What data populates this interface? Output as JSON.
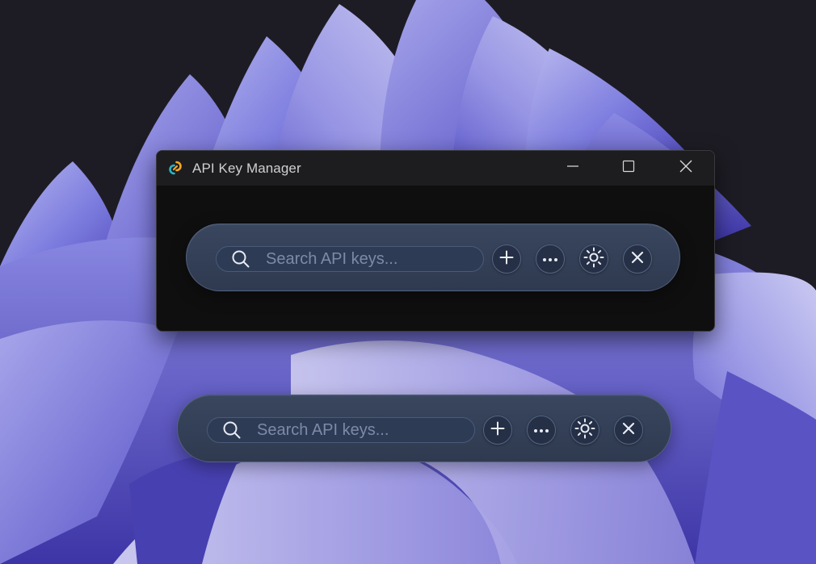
{
  "window": {
    "title": "API Key Manager",
    "app_icon": "link-logo-icon",
    "controls": [
      "minimize-icon",
      "maximize-icon",
      "close-icon"
    ]
  },
  "toolbar": {
    "search_placeholder": "Search API keys...",
    "buttons": [
      {
        "name": "add",
        "icon": "plus-icon"
      },
      {
        "name": "more",
        "icon": "ellipsis-icon"
      },
      {
        "name": "settings",
        "icon": "sun-icon"
      },
      {
        "name": "close",
        "icon": "close-icon"
      }
    ]
  },
  "colors": {
    "desktop_background": "#1d1c24",
    "wallpaper_accent": "#7b7be0",
    "window_background": "#0f0f10",
    "titlebar_background": "#1d1d1f",
    "toolbar_background": "#36435b",
    "placeholder_text": "#7d8aa8",
    "icon_stroke": "#e8ecf4",
    "logo_orange": "#f5a623",
    "logo_teal": "#2bb3c0"
  }
}
